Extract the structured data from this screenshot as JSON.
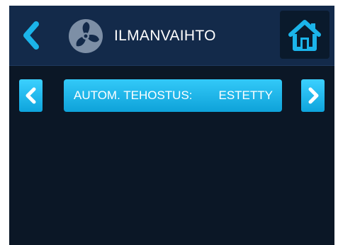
{
  "header": {
    "title": "ILMANVAIHTO",
    "back_icon": "chevron-left-icon",
    "fan_icon": "fan-icon",
    "home_icon": "home-icon"
  },
  "setting": {
    "label": "AUTOM. TEHOSTUS:",
    "value": "ESTETTY",
    "prev_icon": "chevron-left-icon",
    "next_icon": "chevron-right-icon"
  },
  "colors": {
    "background": "#0b1726",
    "header": "#132a4a",
    "accent": "#1bb4ea",
    "text": "#ffffff"
  }
}
